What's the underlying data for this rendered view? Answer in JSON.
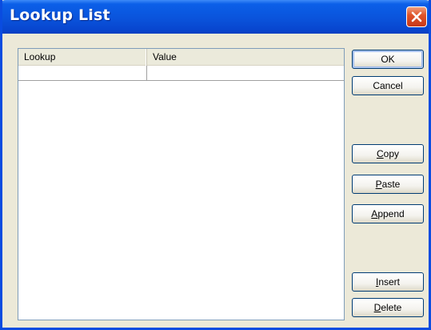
{
  "window": {
    "title": "Lookup List",
    "close_icon": "close-icon"
  },
  "list": {
    "columns": [
      "Lookup",
      "Value"
    ],
    "rows": [
      {
        "lookup": "",
        "value": ""
      }
    ]
  },
  "buttons": {
    "ok": "OK",
    "cancel": "Cancel",
    "copy_key": "C",
    "copy_rest": "opy",
    "paste_key": "P",
    "paste_rest": "aste",
    "append_key": "A",
    "append_rest": "ppend",
    "insert_key": "I",
    "insert_rest": "nsert",
    "delete_key": "D",
    "delete_rest": "elete"
  },
  "colors": {
    "titlebar": "#0a55dd",
    "close": "#e0552a",
    "dialog": "#ece9d8",
    "button_border": "#003c74"
  }
}
